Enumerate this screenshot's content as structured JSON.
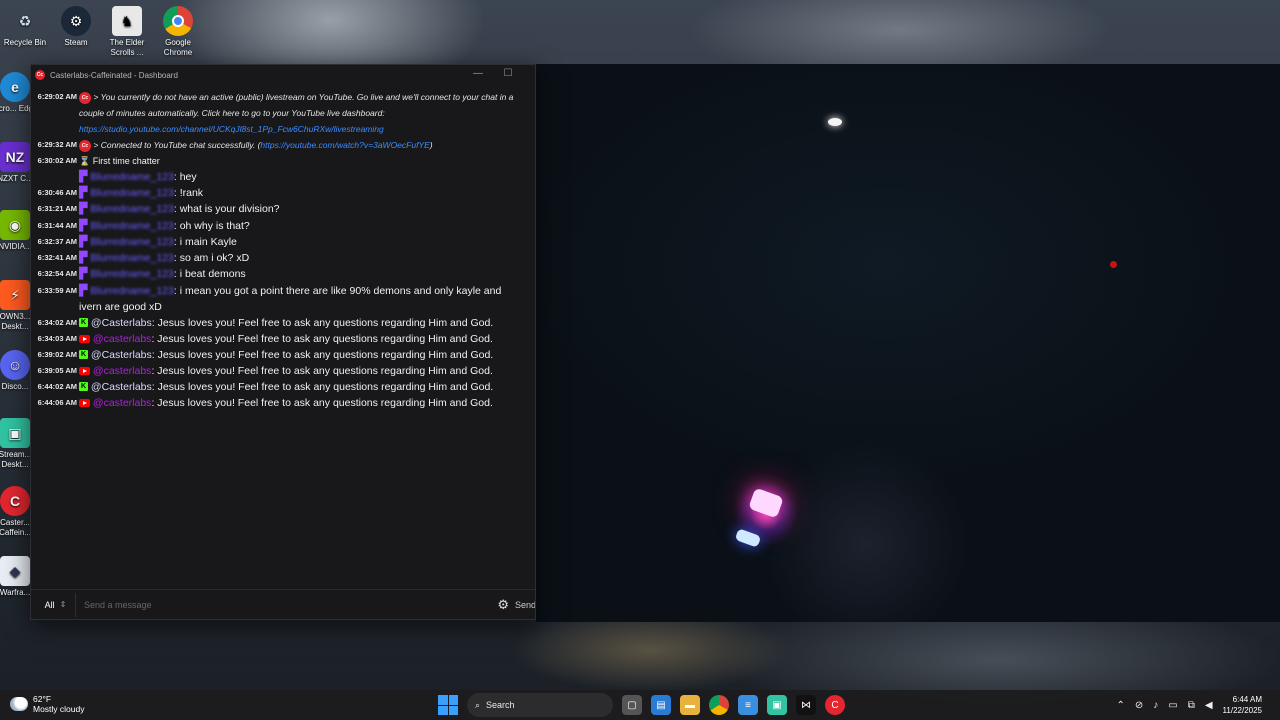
{
  "desktop": {
    "icons": [
      {
        "label": "Recycle Bin",
        "icon": "recycle-bin-icon"
      },
      {
        "label": "Steam",
        "icon": "steam-icon"
      },
      {
        "label": "The Elder Scrolls ...",
        "icon": "elder-scrolls-icon"
      },
      {
        "label": "Google Chrome",
        "icon": "chrome-icon"
      },
      {
        "label": "Micro... Edg...",
        "icon": "edge-icon"
      },
      {
        "label": "NZXT C...",
        "icon": "nzxt-icon"
      },
      {
        "label": "NVIDIA...",
        "icon": "nvidia-icon"
      },
      {
        "label": "OWN3... Deskt...",
        "icon": "own3d-icon"
      },
      {
        "label": "Disco...",
        "icon": "discord-icon"
      },
      {
        "label": "Stream... Deskt...",
        "icon": "streamlabs-icon"
      },
      {
        "label": "Caster... Caffein...",
        "icon": "casterlabs-icon"
      },
      {
        "label": "Warfra...",
        "icon": "warframe-icon"
      }
    ]
  },
  "window": {
    "title": "Casterlabs-Caffeinated - Dashboard",
    "minimize": "—",
    "maximize": "☐",
    "close": "✕"
  },
  "chat": {
    "system_messages": [
      {
        "time": "6:29:02 AM",
        "text": "> You currently do not have an active (public) livestream on YouTube. Go live and we'll connect to your chat in a couple of minutes automatically. Click here to go to your YouTube live dashboard:",
        "link": "https://studio.youtube.com/channel/UCKqJl8st_1Pp_Fcw6ChuRXw/livestreaming"
      },
      {
        "time": "6:29:32 AM",
        "text": "> Connected to YouTube chat successfully. (",
        "link": "https://youtube.com/watch?v=3aWOecFufYE",
        "suffix": ")"
      }
    ],
    "first_time": {
      "time": "6:30:02 AM",
      "label": "First time chatter"
    },
    "twitch_user": "Blurredname_123",
    "twitch_messages": [
      {
        "time": "",
        "text": ": hey"
      },
      {
        "time": "6:30:46 AM",
        "text": ": !rank"
      },
      {
        "time": "6:31:21 AM",
        "text": ": what is your division?"
      },
      {
        "time": "6:31:44 AM",
        "text": ": oh why is that?"
      },
      {
        "time": "6:32:37 AM",
        "text": ": i main Kayle"
      },
      {
        "time": "6:32:41 AM",
        "text": ": so am i ok? xD"
      },
      {
        "time": "6:32:54 AM",
        "text": ": i beat demons"
      },
      {
        "time": "6:33:59 AM",
        "text": ": i mean you got a point there are like 90% demons and only kayle and ivern are good xD"
      }
    ],
    "bot_messages": [
      {
        "time": "6:34:02 AM",
        "platform": "kick",
        "user": "@Casterlabs",
        "text": ": Jesus loves you! Feel free to ask any questions regarding Him and God."
      },
      {
        "time": "6:34:03 AM",
        "platform": "youtube",
        "user": "@casterlabs",
        "text": ": Jesus loves you! Feel free to ask any questions regarding Him and God."
      },
      {
        "time": "6:39:02 AM",
        "platform": "kick",
        "user": "@Casterlabs",
        "text": ": Jesus loves you! Feel free to ask any questions regarding Him and God."
      },
      {
        "time": "6:39:05 AM",
        "platform": "youtube",
        "user": "@casterlabs",
        "text": ": Jesus loves you! Feel free to ask any questions regarding Him and God."
      },
      {
        "time": "6:44:02 AM",
        "platform": "kick",
        "user": "@Casterlabs",
        "text": ": Jesus loves you! Feel free to ask any questions regarding Him and God."
      },
      {
        "time": "6:44:06 AM",
        "platform": "youtube",
        "user": "@casterlabs",
        "text": ": Jesus loves you! Feel free to ask any questions regarding Him and God."
      }
    ]
  },
  "composer": {
    "platform": "All",
    "placeholder": "Send a message",
    "send_label": "Send"
  },
  "taskbar": {
    "weather_temp": "62°F",
    "weather_desc": "Mostly cloudy",
    "search": "Search",
    "time": "6:44 AM",
    "date": "11/22/2025"
  },
  "colors": {
    "twitch": "#9146ff",
    "kick": "#53fc18",
    "youtube": "#ff0000",
    "casterlabs": "#e3262f",
    "link": "#3b8cff"
  }
}
